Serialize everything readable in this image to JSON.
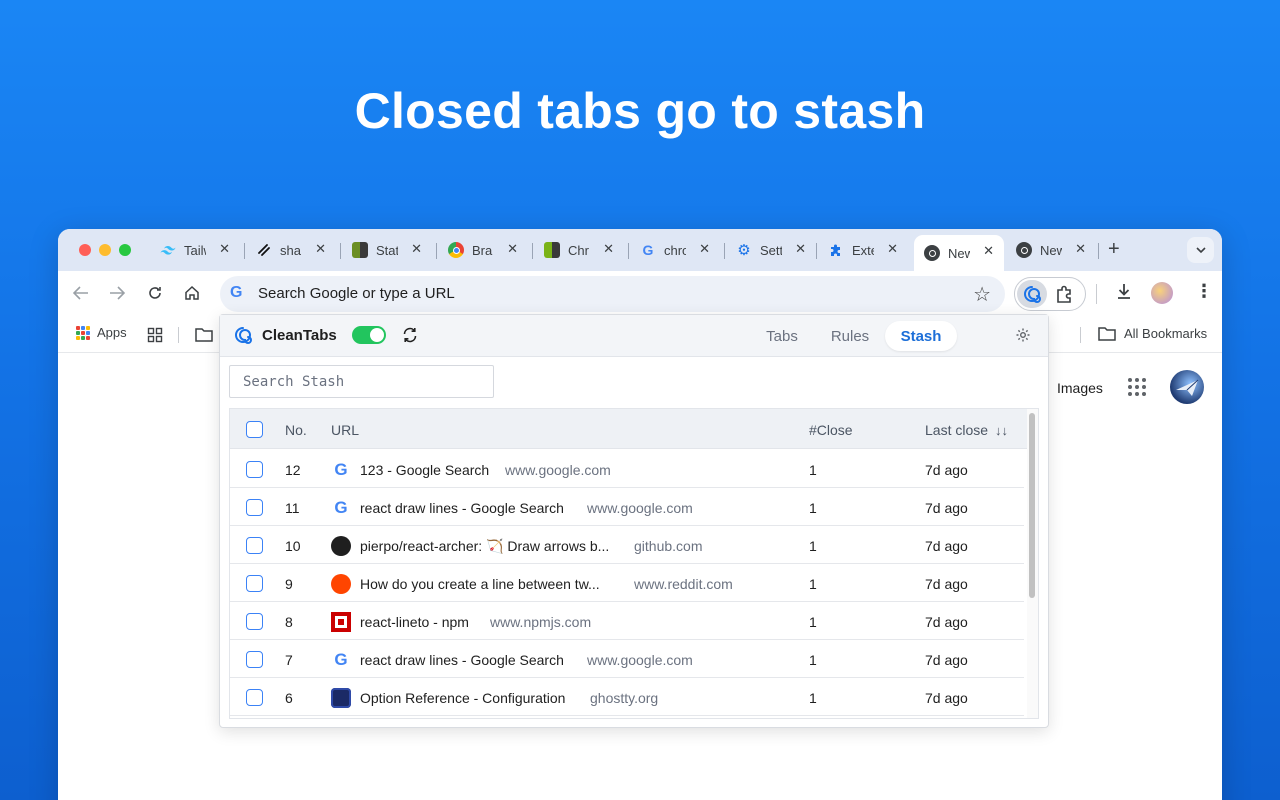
{
  "headline": "Closed tabs go to stash",
  "browser": {
    "tabs": [
      {
        "title": "Tailw",
        "icon": "tailwind-icon"
      },
      {
        "title": "sha",
        "icon": "shadcn-icon"
      },
      {
        "title": "Stat",
        "icon": "stat-icon"
      },
      {
        "title": "Bra",
        "icon": "chrome-icon"
      },
      {
        "title": "Chr",
        "icon": "chrome-web-store-icon"
      },
      {
        "title": "chro",
        "icon": "google-icon"
      },
      {
        "title": "Setti",
        "icon": "gear-icon"
      },
      {
        "title": "Exte",
        "icon": "puzzle-icon"
      },
      {
        "title": "New",
        "icon": "chrome-icon",
        "active": true
      },
      {
        "title": "New",
        "icon": "chrome-icon"
      }
    ],
    "new_tab": "+",
    "omnibox_placeholder": "Search Google or type a URL",
    "bookmarks": {
      "apps": "Apps",
      "all": "All Bookmarks"
    },
    "page": {
      "images_link": "Images"
    }
  },
  "popup": {
    "app_name": "CleanTabs",
    "enabled": true,
    "tabs": [
      {
        "label": "Tabs"
      },
      {
        "label": "Rules"
      },
      {
        "label": "Stash",
        "active": true
      }
    ],
    "search_placeholder": "Search Stash",
    "columns": {
      "no": "No.",
      "url": "URL",
      "close": "#Close",
      "last_close": "Last close"
    },
    "rows": [
      {
        "no": "12",
        "title": "123 - Google Search",
        "domain": "www.google.com",
        "closes": "1",
        "last": "7d ago",
        "icon": "google-icon"
      },
      {
        "no": "11",
        "title": "react draw lines - Google Search",
        "domain": "www.google.com",
        "closes": "1",
        "last": "7d ago",
        "icon": "google-icon"
      },
      {
        "no": "10",
        "title": "pierpo/react-archer: 🏹 Draw arrows b...",
        "domain": "github.com",
        "closes": "1",
        "last": "7d ago",
        "icon": "github-icon"
      },
      {
        "no": "9",
        "title": "How do you create a line between tw...",
        "domain": "www.reddit.com",
        "closes": "1",
        "last": "7d ago",
        "icon": "reddit-icon"
      },
      {
        "no": "8",
        "title": "react-lineto - npm",
        "domain": "www.npmjs.com",
        "closes": "1",
        "last": "7d ago",
        "icon": "npm-icon"
      },
      {
        "no": "7",
        "title": "react draw lines - Google Search",
        "domain": "www.google.com",
        "closes": "1",
        "last": "7d ago",
        "icon": "google-icon"
      },
      {
        "no": "6",
        "title": "Option Reference - Configuration",
        "domain": "ghostty.org",
        "closes": "1",
        "last": "7d ago",
        "icon": "ghostty-icon"
      }
    ]
  }
}
